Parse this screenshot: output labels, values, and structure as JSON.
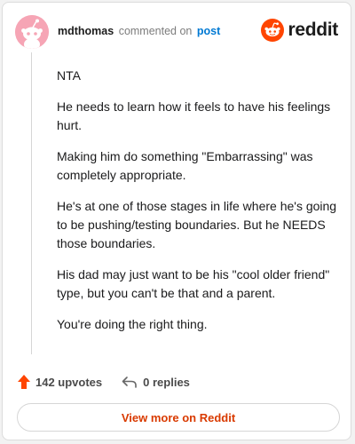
{
  "header": {
    "username": "mdthomas",
    "action_text": "commented on",
    "post_link": "post",
    "brand": "reddit"
  },
  "comment": {
    "paragraphs": [
      "NTA",
      "He needs to learn how it feels to have his feelings hurt.",
      "Making him do something \"Embarrassing\" was completely appropriate.",
      "He's at one of those stages in life where he's going to be pushing/testing boundaries. But he NEEDS those boundaries.",
      "His dad may just want to be his \"cool older friend\" type, but you can't be that and a parent.",
      "You're doing the right thing."
    ]
  },
  "actions": {
    "upvotes": "142 upvotes",
    "replies": "0 replies"
  },
  "footer": {
    "view_more": "View more on Reddit"
  },
  "colors": {
    "accent": "#ff4500",
    "link": "#0079d3",
    "view_more_text": "#d93a00",
    "avatar_bg": "#f6a5b5"
  },
  "icons": {
    "avatar": "snoo-avatar-icon",
    "brand": "reddit-logo-icon",
    "upvote": "upvote-arrow-icon",
    "reply": "reply-arrow-icon"
  }
}
